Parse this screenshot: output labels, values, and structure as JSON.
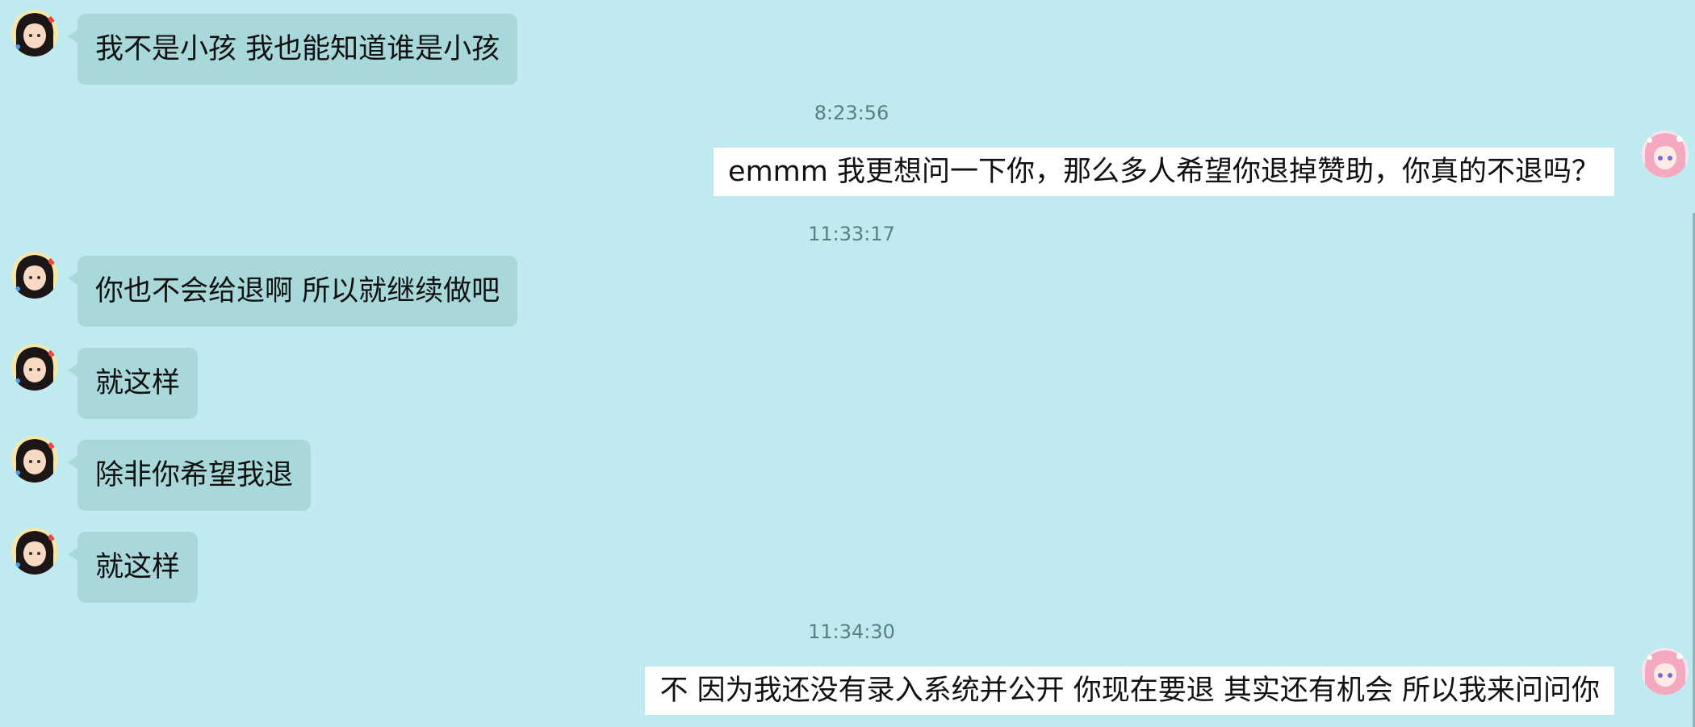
{
  "messages": [
    {
      "type": "in",
      "text": "我不是小孩 我也能知道谁是小孩",
      "avatar": "girl-dark-hair-avatar"
    },
    {
      "type": "time",
      "text": "8:23:56"
    },
    {
      "type": "out",
      "text": "emmm 我更想问一下你，那么多人希望你退掉赞助，你真的不退吗？",
      "avatar": "girl-pink-hair-avatar"
    },
    {
      "type": "time",
      "text": "11:33:17"
    },
    {
      "type": "in",
      "text": "你也不会给退啊  所以就继续做吧",
      "avatar": "girl-dark-hair-avatar"
    },
    {
      "type": "in",
      "text": "就这样",
      "avatar": "girl-dark-hair-avatar"
    },
    {
      "type": "in",
      "text": "除非你希望我退",
      "avatar": "girl-dark-hair-avatar"
    },
    {
      "type": "in",
      "text": "就这样",
      "avatar": "girl-dark-hair-avatar"
    },
    {
      "type": "time",
      "text": "11:34:30"
    },
    {
      "type": "out",
      "text": "不 因为我还没有录入系统并公开 你现在要退 其实还有机会 所以我来问问你",
      "avatar": "girl-pink-hair-avatar"
    }
  ],
  "colors": {
    "background": "#bfebf0",
    "incoming_bubble": "#a9d8db",
    "outgoing_bubble": "#ffffff",
    "timestamp_text": "#5d7c80"
  }
}
